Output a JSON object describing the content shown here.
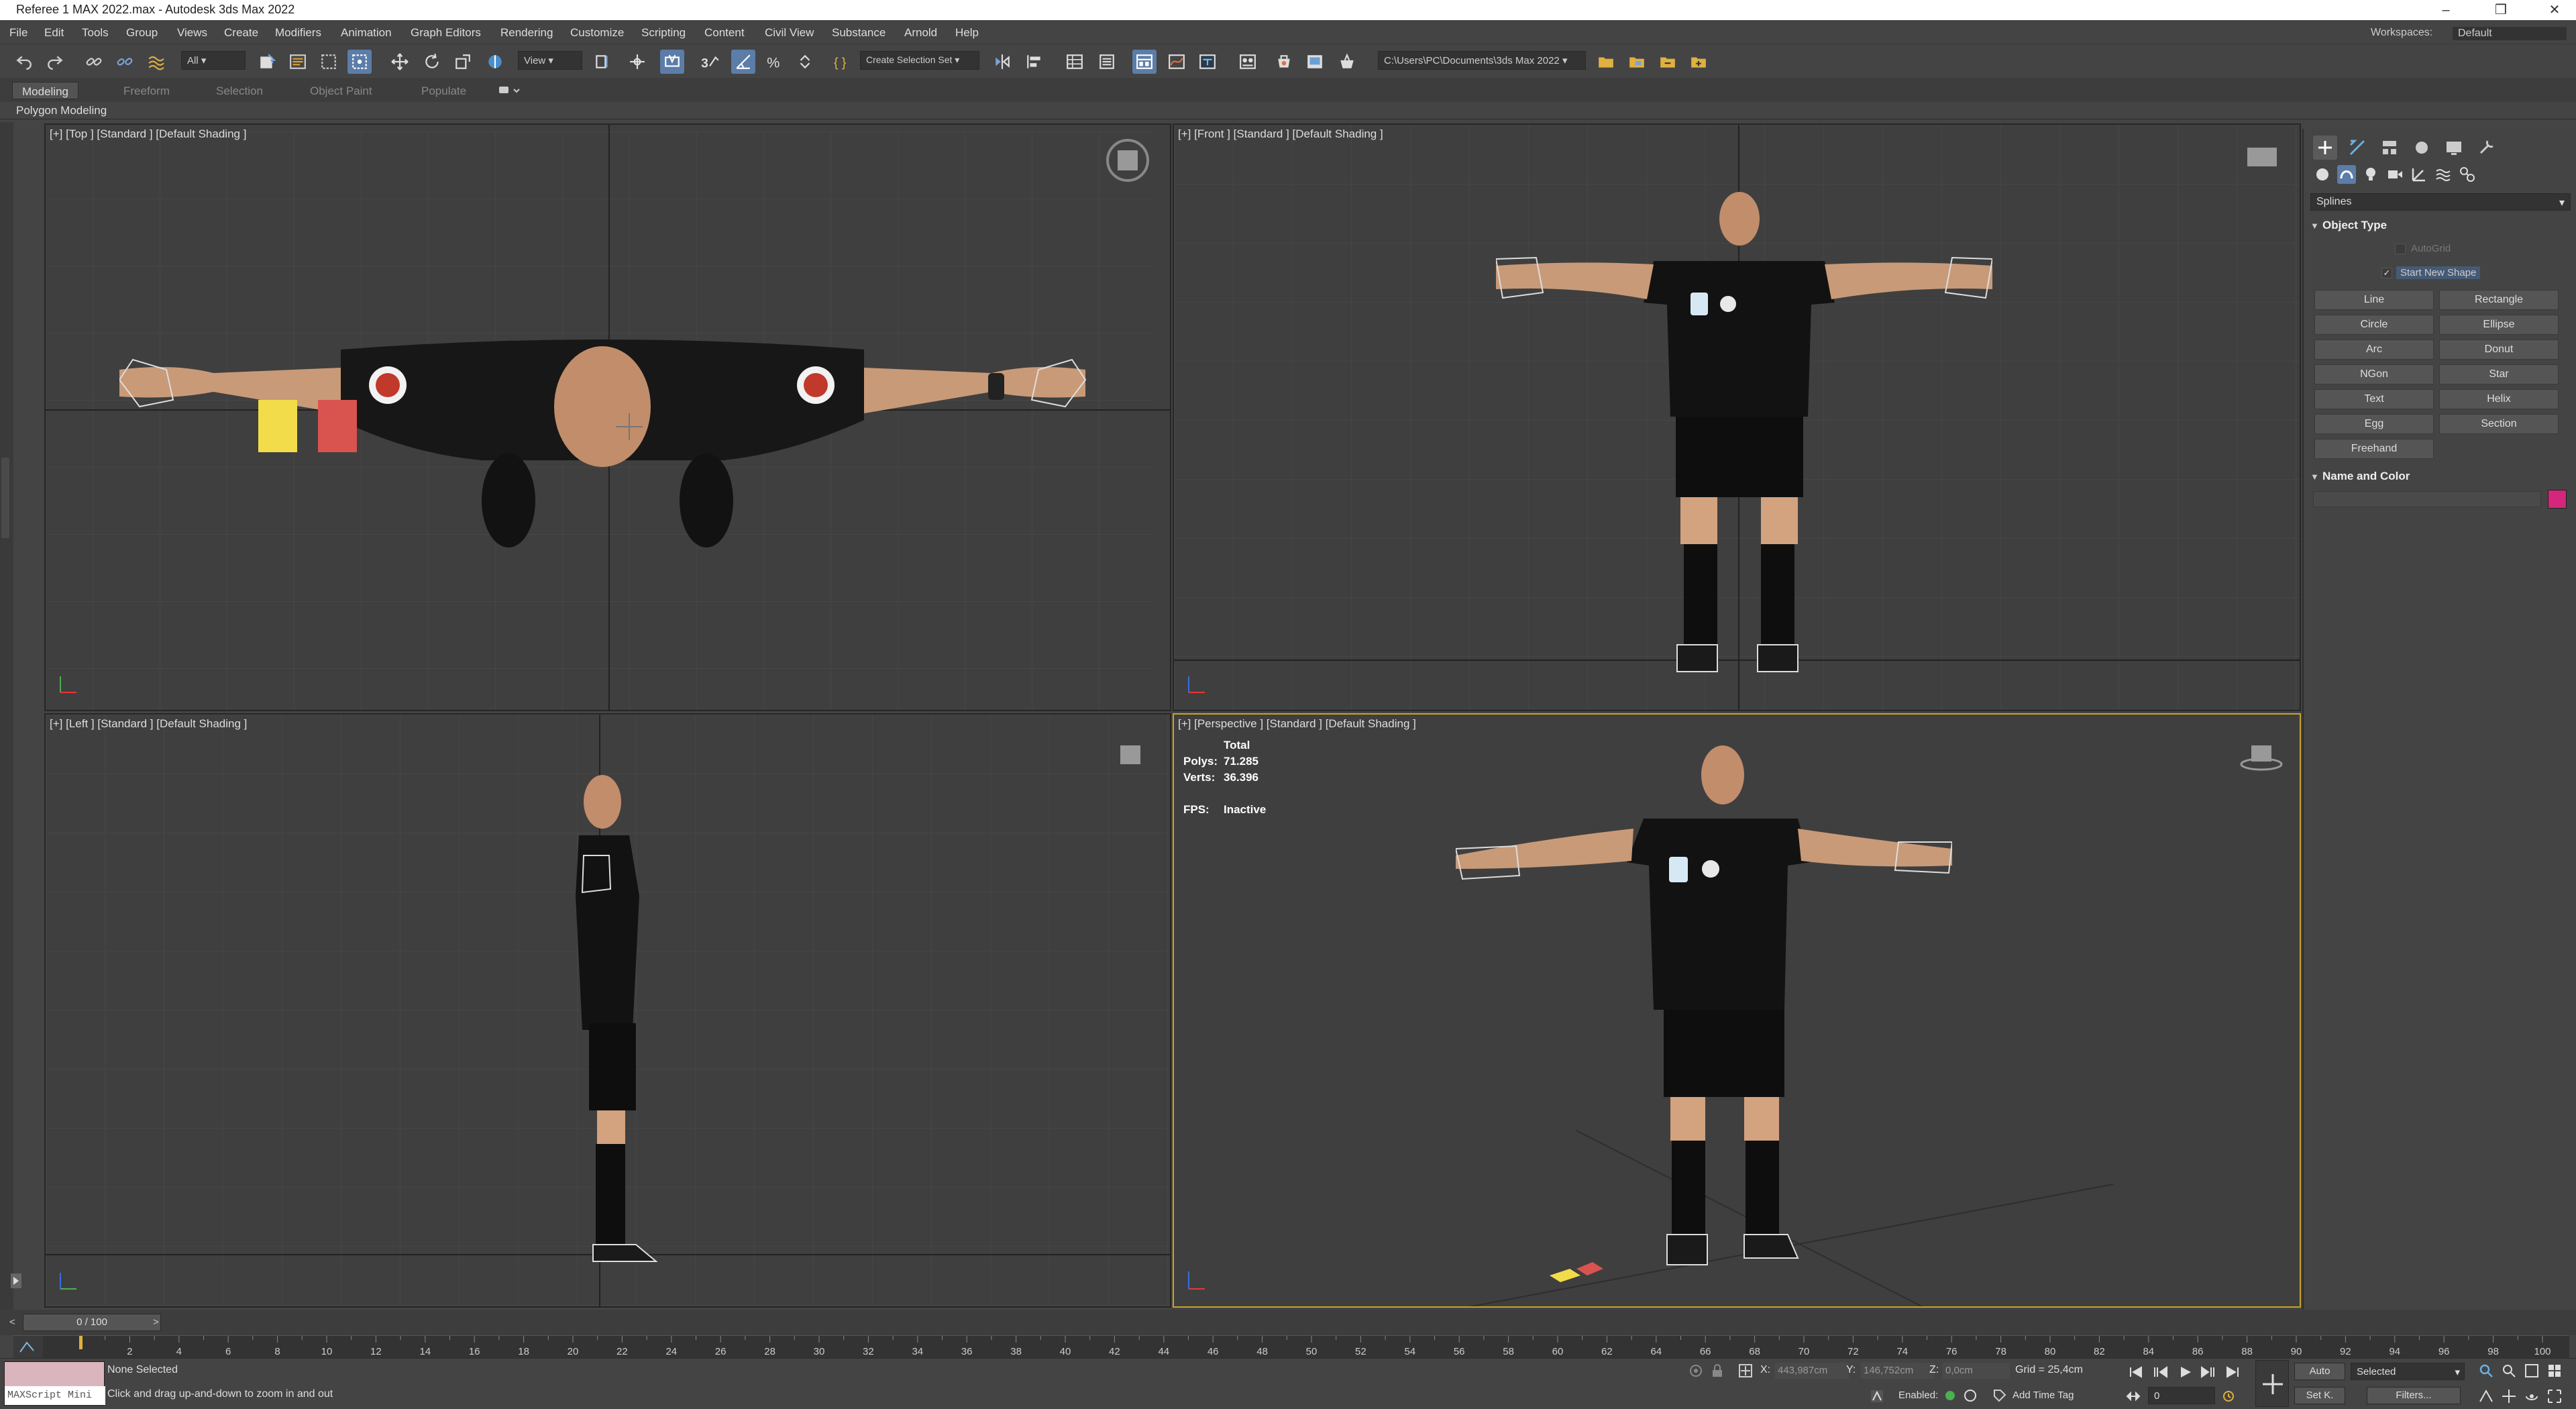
{
  "window": {
    "title": "Referee 1 MAX 2022.max - Autodesk 3ds Max 2022",
    "controls": [
      "–",
      "❒",
      "✕"
    ]
  },
  "menu": [
    "File",
    "Edit",
    "Tools",
    "Group",
    "Views",
    "Create",
    "Modifiers",
    "Animation",
    "Graph Editors",
    "Rendering",
    "Customize",
    "Scripting",
    "Content",
    "Civil View",
    "Substance",
    "Arnold",
    "Help"
  ],
  "workspace": {
    "label": "Workspaces:",
    "value": "Default"
  },
  "toolbar": {
    "selection_filter": "All",
    "ref_coord": "View",
    "selection_set": "Create Selection Set",
    "project_path": "C:\\Users\\PC\\Documents\\3ds Max 2022"
  },
  "ribbon": {
    "tabs": [
      "Modeling",
      "Freeform",
      "Selection",
      "Object Paint",
      "Populate"
    ],
    "active_tab": "Modeling",
    "panel_label": "Polygon Modeling"
  },
  "viewports": {
    "top": {
      "label": "[+] [Top ] [Standard ] [Default Shading ]"
    },
    "front": {
      "label": "[+] [Front ] [Standard ] [Default Shading ]"
    },
    "left": {
      "label": "[+] [Left ] [Standard ] [Default Shading ]"
    },
    "perspective": {
      "label": "[+] [Perspective ] [Standard ] [Default Shading ]",
      "stats": {
        "total_label": "Total",
        "polys_label": "Polys:",
        "polys": "71.285",
        "verts_label": "Verts:",
        "verts": "36.396",
        "fps_label": "FPS:",
        "fps": "Inactive"
      }
    }
  },
  "command_panel": {
    "category": "Splines",
    "object_type_title": "Object Type",
    "autogrid": "AutoGrid",
    "start_new_shape": "Start New Shape",
    "buttons": [
      "Line",
      "Rectangle",
      "Circle",
      "Ellipse",
      "Arc",
      "Donut",
      "NGon",
      "Star",
      "Text",
      "Helix",
      "Egg",
      "Section",
      "Freehand"
    ],
    "name_color_title": "Name and Color",
    "swatch_color": "#d4267a"
  },
  "timeline": {
    "frame_display": "0 / 100",
    "ticks": [
      0,
      2,
      4,
      6,
      8,
      10,
      12,
      14,
      16,
      18,
      20,
      22,
      24,
      26,
      28,
      30,
      32,
      34,
      36,
      38,
      40,
      42,
      44,
      46,
      48,
      50,
      52,
      54,
      56,
      58,
      60,
      62,
      64,
      66,
      68,
      70,
      72,
      74,
      76,
      78,
      80,
      82,
      84,
      86,
      88,
      90,
      92,
      94,
      96,
      98,
      100
    ],
    "current_frame": 0,
    "total_frames": 100
  },
  "status": {
    "maxscript": "MAXScript Mini",
    "selection": "None Selected",
    "prompt": "Click and drag up-and-down to zoom in and out",
    "x_label": "X:",
    "x": "443,987cm",
    "y_label": "Y:",
    "y": "146,752cm",
    "z_label": "Z:",
    "z": "0,0cm",
    "grid": "Grid = 25,4cm",
    "auto": "Auto",
    "set_k": "Set K.",
    "key_mode": "Selected",
    "filters": "Filters...",
    "frame_field": "0",
    "enabled_label": "Enabled:",
    "time_tag": "Add Time Tag"
  },
  "colors": {
    "accent": "#5b7da8",
    "active_viewport": "#c9a227",
    "yellow_card": "#f2dc4a",
    "red_card": "#d9534f"
  }
}
